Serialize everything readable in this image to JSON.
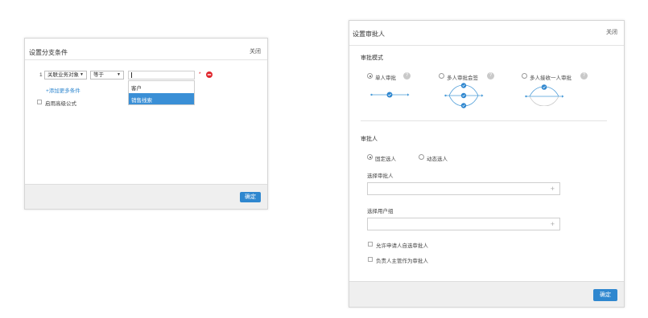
{
  "branch_dialog": {
    "title": "设置分支条件",
    "close": "关闭",
    "row_index": "1",
    "object_select": "关联业务对象",
    "operator_select": "等于",
    "value_input": "",
    "required_mark": "*",
    "add_condition": "+添加更多条件",
    "advanced_formula": "启用高级公式",
    "dropdown_options": [
      "客户",
      "销售线索"
    ],
    "selected_option": "销售线索",
    "ok": "确定"
  },
  "approver_dialog": {
    "title": "设置审批人",
    "close": "关闭",
    "mode_section": "审批模式",
    "modes": [
      {
        "label": "单人审批",
        "selected": true
      },
      {
        "label": "多人审批会签",
        "selected": false
      },
      {
        "label": "多人接收一人审批",
        "selected": false
      }
    ],
    "approver_section": "审批人",
    "approver_types": [
      {
        "label": "固定选人",
        "selected": true
      },
      {
        "label": "动态选人",
        "selected": false
      }
    ],
    "select_approver_label": "选择审批人",
    "select_group_label": "选择用户组",
    "plus_icon": "+",
    "allow_self_select": "允许申请人自选审批人",
    "leader_as_approver": "负责人主管作为审批人",
    "ok": "确定"
  },
  "colors": {
    "accent": "#2f87cf",
    "selected_option_bg": "#3a8fd6",
    "delete": "#e0262d",
    "help": "#c9c9c9"
  }
}
